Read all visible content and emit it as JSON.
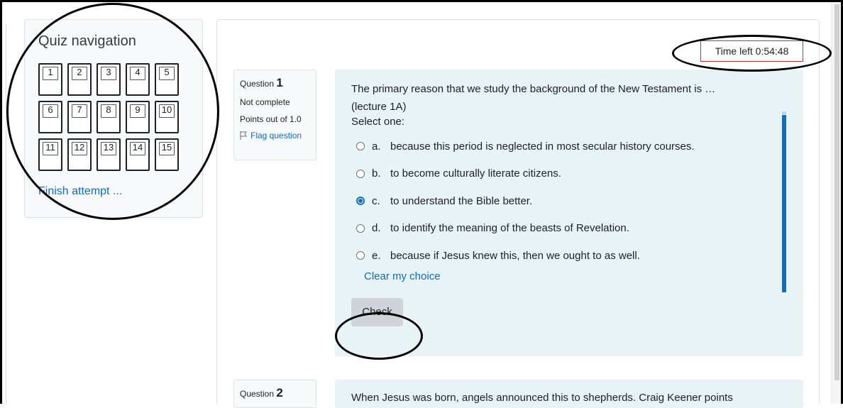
{
  "quiz_nav": {
    "title": "Quiz navigation",
    "buttons": [
      "1",
      "2",
      "3",
      "4",
      "5",
      "6",
      "7",
      "8",
      "9",
      "10",
      "11",
      "12",
      "13",
      "14",
      "15"
    ],
    "finish_link": "Finish attempt ..."
  },
  "timer": {
    "label": "Time left 0:54:48"
  },
  "question1": {
    "label": "Question",
    "number": "1",
    "state": "Not complete",
    "grade": "Points out of 1.0",
    "flag": "Flag question",
    "text": "The primary reason that we study the background of the New Testament is … (lecture 1A)",
    "prompt": "Select one:",
    "answers": [
      {
        "letter": "a.",
        "text": "because this period is neglected in most secular history courses.",
        "selected": false
      },
      {
        "letter": "b.",
        "text": "to become culturally literate citizens.",
        "selected": false
      },
      {
        "letter": "c.",
        "text": "to understand the Bible better.",
        "selected": true
      },
      {
        "letter": "d.",
        "text": "to identify the meaning of the beasts of Revelation.",
        "selected": false
      },
      {
        "letter": "e.",
        "text": "because if Jesus knew this, then we ought to as well.",
        "selected": false
      }
    ],
    "clear_choice": "Clear my choice",
    "check_button": "Check"
  },
  "question2": {
    "label": "Question",
    "number": "2",
    "text": "When Jesus was born, angels announced this to shepherds. Craig Keener points"
  },
  "colors": {
    "link": "#0f6cbf",
    "content_bg": "#e7f3f5",
    "timer_border": "#ca3120",
    "annotation": "#000000"
  }
}
